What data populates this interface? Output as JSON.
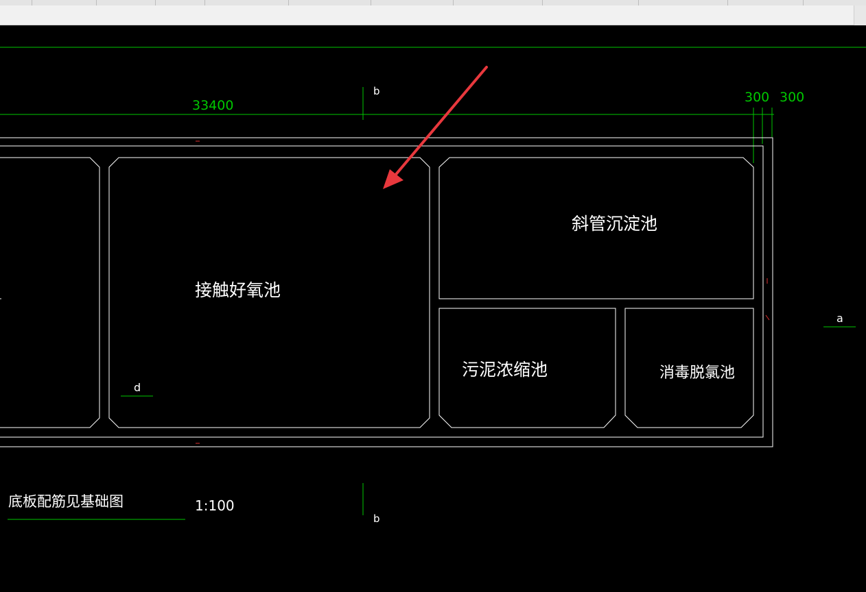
{
  "drawing": {
    "rooms": {
      "contact_oxidation": "接触好氧池",
      "inclined_tube": "斜管沉淀池",
      "sludge_thickening": "污泥浓缩池",
      "disinfection": "消毒脱氯池"
    },
    "dimensions": {
      "total_length": "33400",
      "wall_left": "300",
      "wall_right": "300"
    },
    "section_marks": {
      "b_top": "b",
      "b_bottom": "b",
      "a_right": "a",
      "d_left": "d"
    },
    "notes": {
      "base_note": "底板配筋见基础图",
      "scale": "1:100"
    },
    "colors": {
      "background": "#000000",
      "outline": "#ffffff",
      "dimension": "#00c800",
      "annotation_arrow": "#e8383d"
    }
  }
}
